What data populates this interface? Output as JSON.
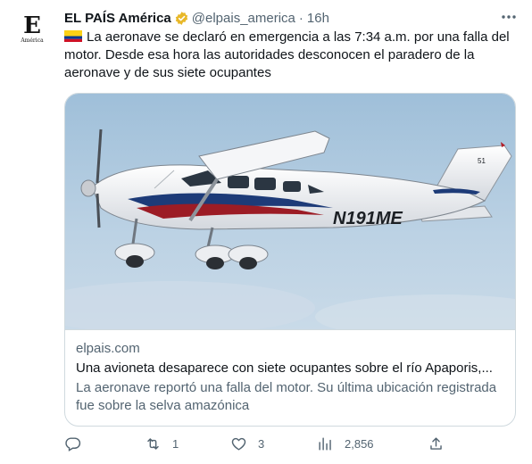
{
  "author": {
    "name": "EL PAÍS América",
    "handle": "@elpais_america",
    "separator": "·",
    "time": "16h",
    "avatar_letter": "E",
    "avatar_sub": "América"
  },
  "tweet": {
    "text": "La aeronave se declaró en emergencia a las 7:34 a.m. por una falla del motor. Desde esa hora las autoridades desconocen el paradero de la aeronave y de sus siete ocupantes"
  },
  "card": {
    "image_label": "N191ME",
    "tail_number": "51",
    "domain": "elpais.com",
    "title": "Una avioneta desaparece con siete ocupantes sobre el río Apaporis,...",
    "description": "La aeronave reportó una falla del motor. Su última ubicación registrada fue sobre la selva amazónica"
  },
  "actions": {
    "reply": "",
    "retweet": "1",
    "like": "3",
    "views": "2,856"
  },
  "colors": {
    "verified": "#e8b829",
    "secondary_text": "#536471",
    "border": "#cfd9de"
  },
  "icons": [
    "verified-badge-icon",
    "more-icon",
    "colombia-flag-icon",
    "reply-icon",
    "retweet-icon",
    "like-icon",
    "views-icon",
    "share-icon"
  ]
}
